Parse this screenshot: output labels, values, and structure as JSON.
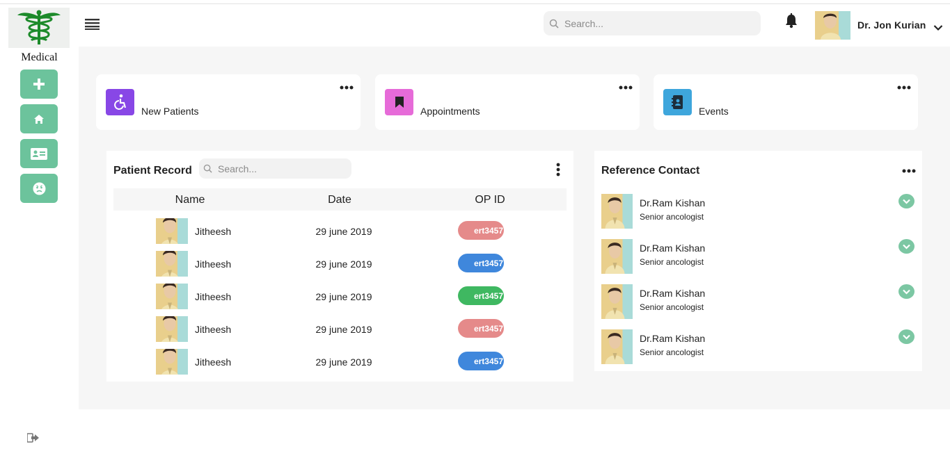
{
  "sidebar": {
    "logo_text": "Medical",
    "buttons": [
      "plus-icon",
      "home-icon",
      "id-card-icon",
      "face-icon"
    ],
    "accent": "#6cc39c"
  },
  "topbar": {
    "search_placeholder": "Search...",
    "user_name": "Dr. Jon Kurian"
  },
  "cards": [
    {
      "label": "New Patients",
      "icon": "wheelchair-icon",
      "color": "#8847e6"
    },
    {
      "label": "Appointments",
      "icon": "bookmark-icon",
      "color": "#e66bd8"
    },
    {
      "label": "Events",
      "icon": "contact-book-icon",
      "color": "#3ea6dc"
    }
  ],
  "patient_record": {
    "title": "Patient Record",
    "search_placeholder": "Search...",
    "columns": [
      "Name",
      "Date",
      "OP ID"
    ],
    "rows": [
      {
        "name": "Jitheesh",
        "date": "29 june 2019",
        "op_id": "ert3457",
        "badge_color": "#e58a8a"
      },
      {
        "name": "Jitheesh",
        "date": "29 june 2019",
        "op_id": "ert3457",
        "badge_color": "#3f87dc"
      },
      {
        "name": "Jitheesh",
        "date": "29 june 2019",
        "op_id": "ert3457",
        "badge_color": "#3fb861"
      },
      {
        "name": "Jitheesh",
        "date": "29 june 2019",
        "op_id": "ert3457",
        "badge_color": "#e58a8a"
      },
      {
        "name": "Jitheesh",
        "date": "29 june 2019",
        "op_id": "ert3457",
        "badge_color": "#3f87dc"
      }
    ]
  },
  "reference_contact": {
    "title": "Reference Contact",
    "contacts": [
      {
        "name": "Dr.Ram Kishan",
        "role": "Senior ancologist"
      },
      {
        "name": "Dr.Ram Kishan",
        "role": "Senior ancologist"
      },
      {
        "name": "Dr.Ram Kishan",
        "role": "Senior ancologist"
      },
      {
        "name": "Dr.Ram Kishan",
        "role": "Senior ancologist"
      }
    ]
  }
}
